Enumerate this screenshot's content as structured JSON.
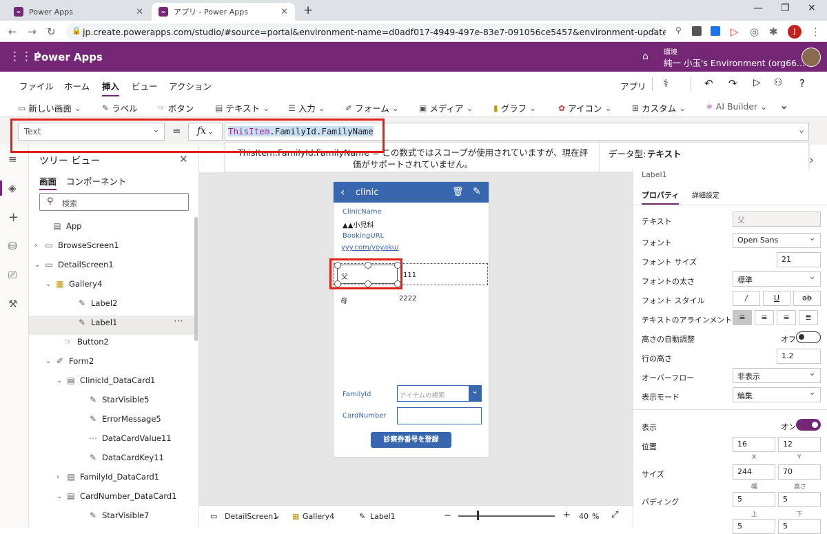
{
  "browser": {
    "tab1": "Power Apps",
    "tab2": "アプリ - Power Apps",
    "url": "jp.create.powerapps.com/studio/#source=portal&environment-name=d0adf017-4949-497e-83e7-091056ce5457&environment-update-cadence=...",
    "profile_initial": "J"
  },
  "header": {
    "app_name": "Power Apps",
    "env_label": "環境",
    "env_name": "純一 小玉's Environment (org66..."
  },
  "menu": {
    "tabs": [
      "ファイル",
      "ホーム",
      "挿入",
      "ビュー",
      "アクション"
    ],
    "active": "挿入",
    "app_label": "アプリ"
  },
  "ribbon": {
    "new_screen": "新しい画面",
    "label": "ラベル",
    "button": "ボタン",
    "text": "テキスト",
    "input": "入力",
    "form": "フォーム",
    "media": "メディア",
    "chart": "グラフ",
    "icon": "アイコン",
    "custom": "カスタム",
    "ai_builder": "AI Builder"
  },
  "formula_bar": {
    "property": "Text",
    "equals": "=",
    "fx": "fx",
    "formula_part1": "ThisItem",
    "formula_part2": ".FamilyId.FamilyName",
    "tooltip_formula": "ThisItem.FamilyId.FamilyName",
    "tooltip_eq": "=",
    "tooltip_msg": "この数式ではスコープが使用されていますが、現在評価がサポートされていません。",
    "data_type_label": "データ型:",
    "data_type_value": "テキスト"
  },
  "tree": {
    "title": "ツリー ビュー",
    "tab_screens": "画面",
    "tab_components": "コンポーネント",
    "search_placeholder": "検索",
    "items": [
      {
        "label": "App",
        "icon": "app-icon"
      },
      {
        "label": "BrowseScreen1",
        "icon": "screen-icon"
      },
      {
        "label": "DetailScreen1",
        "icon": "screen-icon"
      },
      {
        "label": "Gallery4",
        "icon": "gallery-icon"
      },
      {
        "label": "Label2",
        "icon": "label-icon"
      },
      {
        "label": "Label1",
        "icon": "label-icon"
      },
      {
        "label": "Button2",
        "icon": "button-icon"
      },
      {
        "label": "Form2",
        "icon": "form-icon"
      },
      {
        "label": "ClinicId_DataCard1",
        "icon": "card-icon"
      },
      {
        "label": "StarVisible5",
        "icon": "label-icon"
      },
      {
        "label": "ErrorMessage5",
        "icon": "label-icon"
      },
      {
        "label": "DataCardValue11",
        "icon": "input-icon"
      },
      {
        "label": "DataCardKey11",
        "icon": "label-icon"
      },
      {
        "label": "FamilyId_DataCard1",
        "icon": "card-icon"
      },
      {
        "label": "CardNumber_DataCard1",
        "icon": "card-icon"
      },
      {
        "label": "StarVisible7",
        "icon": "label-icon"
      }
    ]
  },
  "device": {
    "title": "clinic",
    "clinic_name_label": "ClinicName",
    "clinic_name_value": "▲▲小児科",
    "booking_label": "BookingURL",
    "booking_value": "yyy.com/yoyaku/",
    "row1_name": "父",
    "row1_num": "111",
    "row2_name": "母",
    "row2_num": "2222",
    "family_label": "FamilyId",
    "family_placeholder": "アイテムの検索",
    "card_label": "CardNumber",
    "register_button": "診察券番号を登録"
  },
  "status": {
    "screen": "DetailScreen1",
    "gallery": "Gallery4",
    "label": "Label1",
    "zoom": "40",
    "zoom_unit": "%"
  },
  "props": {
    "control_name": "Label1",
    "tab_props": "プロパティ",
    "tab_advanced": "詳細設定",
    "text_label": "テキスト",
    "text_value": "父",
    "font_label": "フォント",
    "font_value": "Open Sans",
    "font_size_label": "フォント サイズ",
    "font_size_value": "21",
    "font_weight_label": "フォントの太さ",
    "font_weight_value": "標準",
    "font_style_label": "フォント スタイル",
    "align_label": "テキストのアラインメント",
    "autoheight_label": "高さの自動調整",
    "autoheight_value": "オフ",
    "line_height_label": "行の高さ",
    "line_height_value": "1.2",
    "overflow_label": "オーバーフロー",
    "overflow_value": "非表示",
    "display_mode_label": "表示モード",
    "display_mode_value": "編集",
    "visible_label": "表示",
    "visible_value": "オン",
    "position_label": "位置",
    "pos_x": "16",
    "pos_y": "12",
    "x_label": "X",
    "y_label": "Y",
    "size_label": "サイズ",
    "width": "244",
    "height": "70",
    "w_label": "幅",
    "h_label": "高さ",
    "padding_label": "パディング",
    "pad_top": "5",
    "pad_bottom": "5",
    "top_label": "上",
    "bottom_label": "下",
    "pad_left": "5",
    "pad_right": "5"
  },
  "colors": {
    "brand": "#742774",
    "accent": "#3867b0",
    "highlight": "#e0201b"
  }
}
